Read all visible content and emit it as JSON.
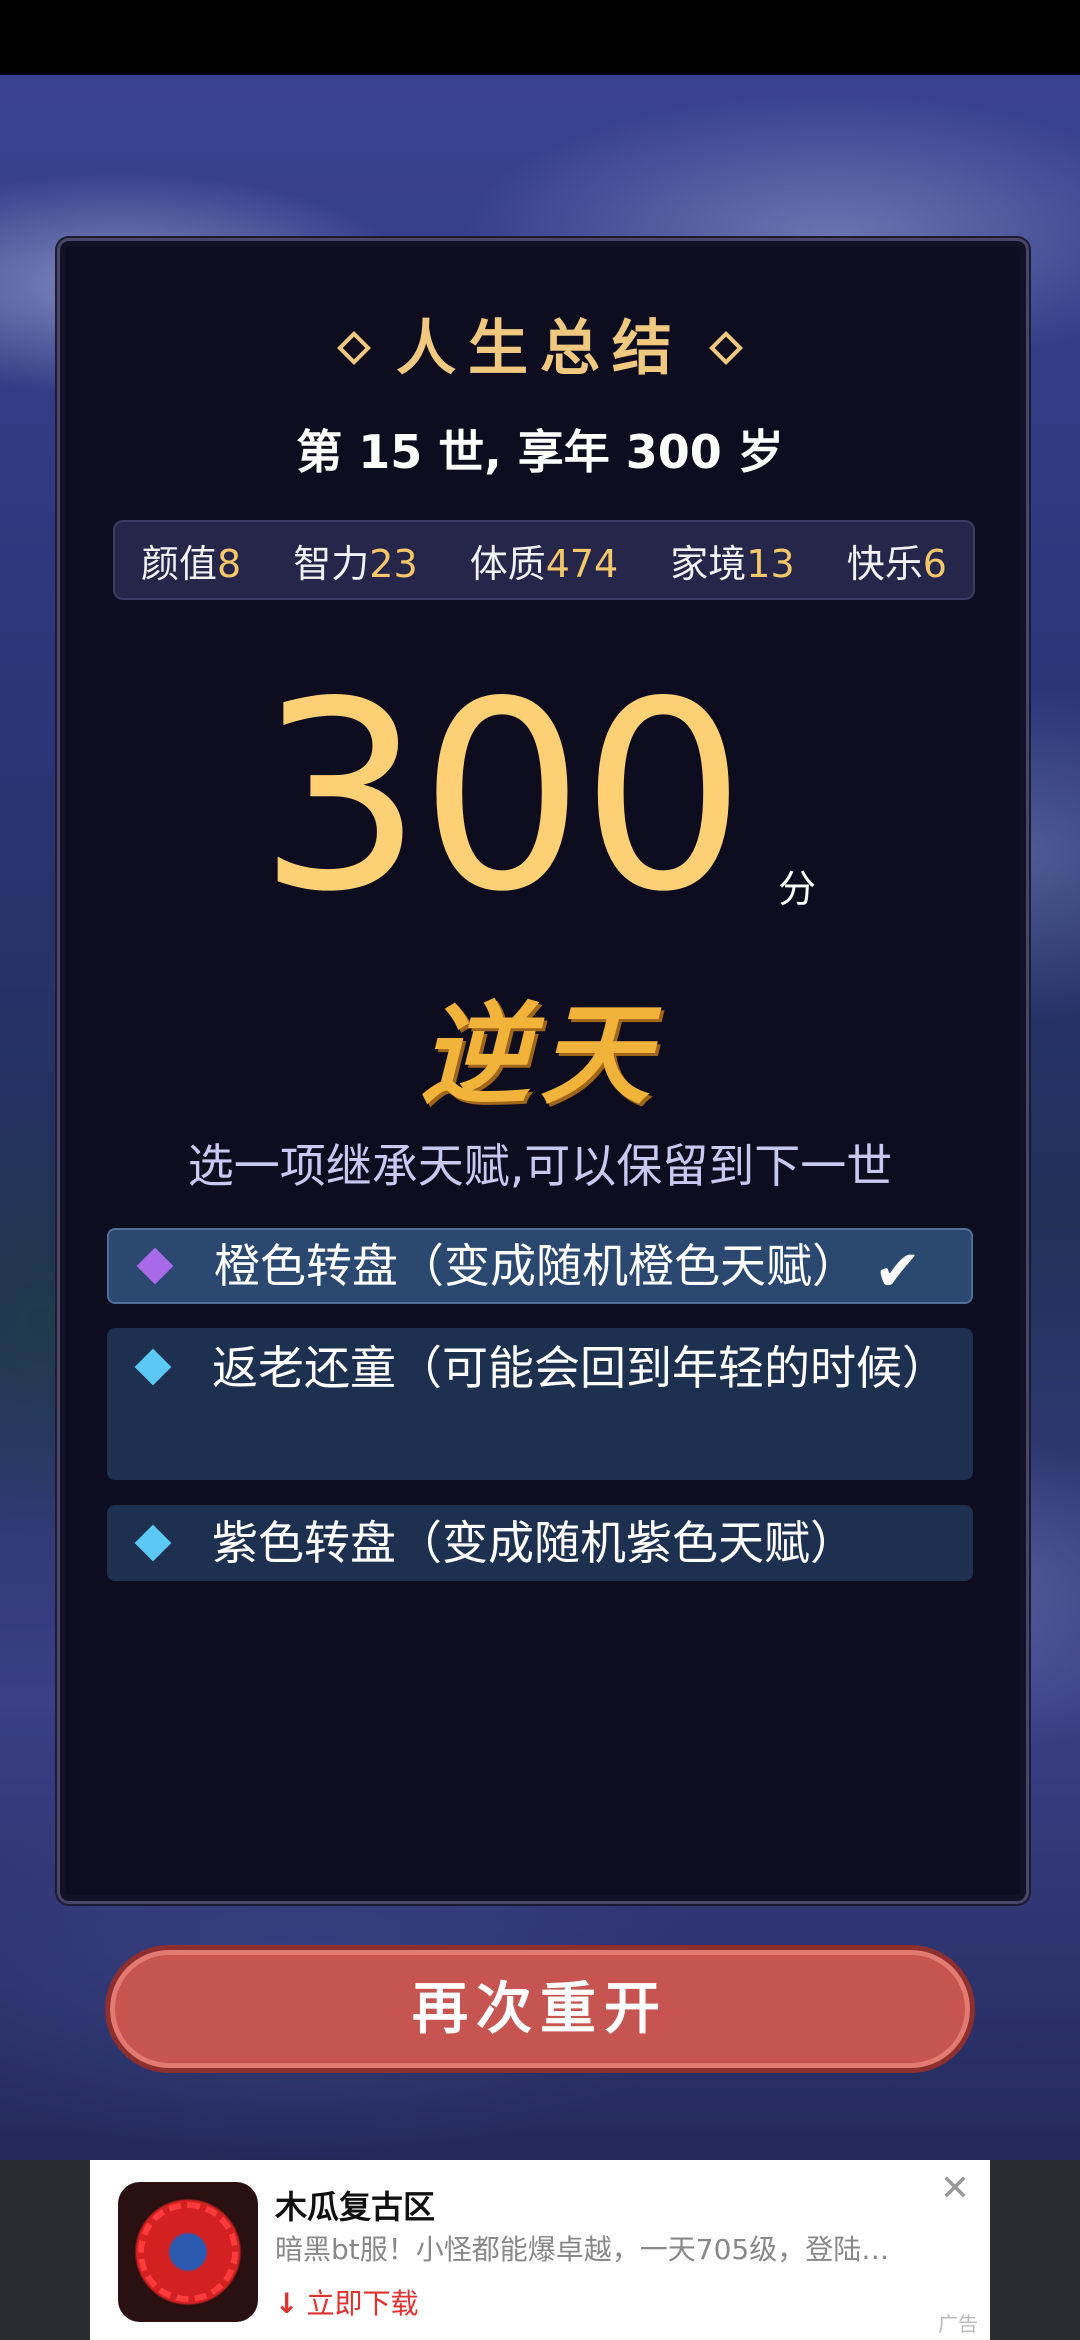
{
  "summary": {
    "title": "人生总结",
    "life_line": "第 15 世, 享年 300 岁",
    "stats": [
      {
        "label": "颜值",
        "value": "8"
      },
      {
        "label": "智力",
        "value": "23"
      },
      {
        "label": "体质",
        "value": "474"
      },
      {
        "label": "家境",
        "value": "13"
      },
      {
        "label": "快乐",
        "value": "6"
      }
    ],
    "score": "300",
    "score_unit": "分",
    "grade": "逆天",
    "prompt": "选一项继承天赋,可以保留到下一世"
  },
  "options": [
    {
      "text": "橙色转盘（变成随机橙色天赋）",
      "selected": true,
      "diamond_color": "#a86ae8",
      "check": "✔"
    },
    {
      "text": "返老还童（可能会回到年轻的时候）",
      "selected": false,
      "diamond_color": "#5bc8f5"
    },
    {
      "text": "紫色转盘（变成随机紫色天赋）",
      "selected": false,
      "diamond_color": "#5bc8f5"
    }
  ],
  "restart_button": "再次重开",
  "ad": {
    "title": "木瓜复古区",
    "description": "暗黑bt服！小怪都能爆卓越，一天705级，登陆…",
    "download_label": "立即下载",
    "badge": "广告",
    "close": "✕"
  },
  "colors": {
    "gold": "#fdd076",
    "panel": "#0d0d1f",
    "button": "#c65551"
  }
}
